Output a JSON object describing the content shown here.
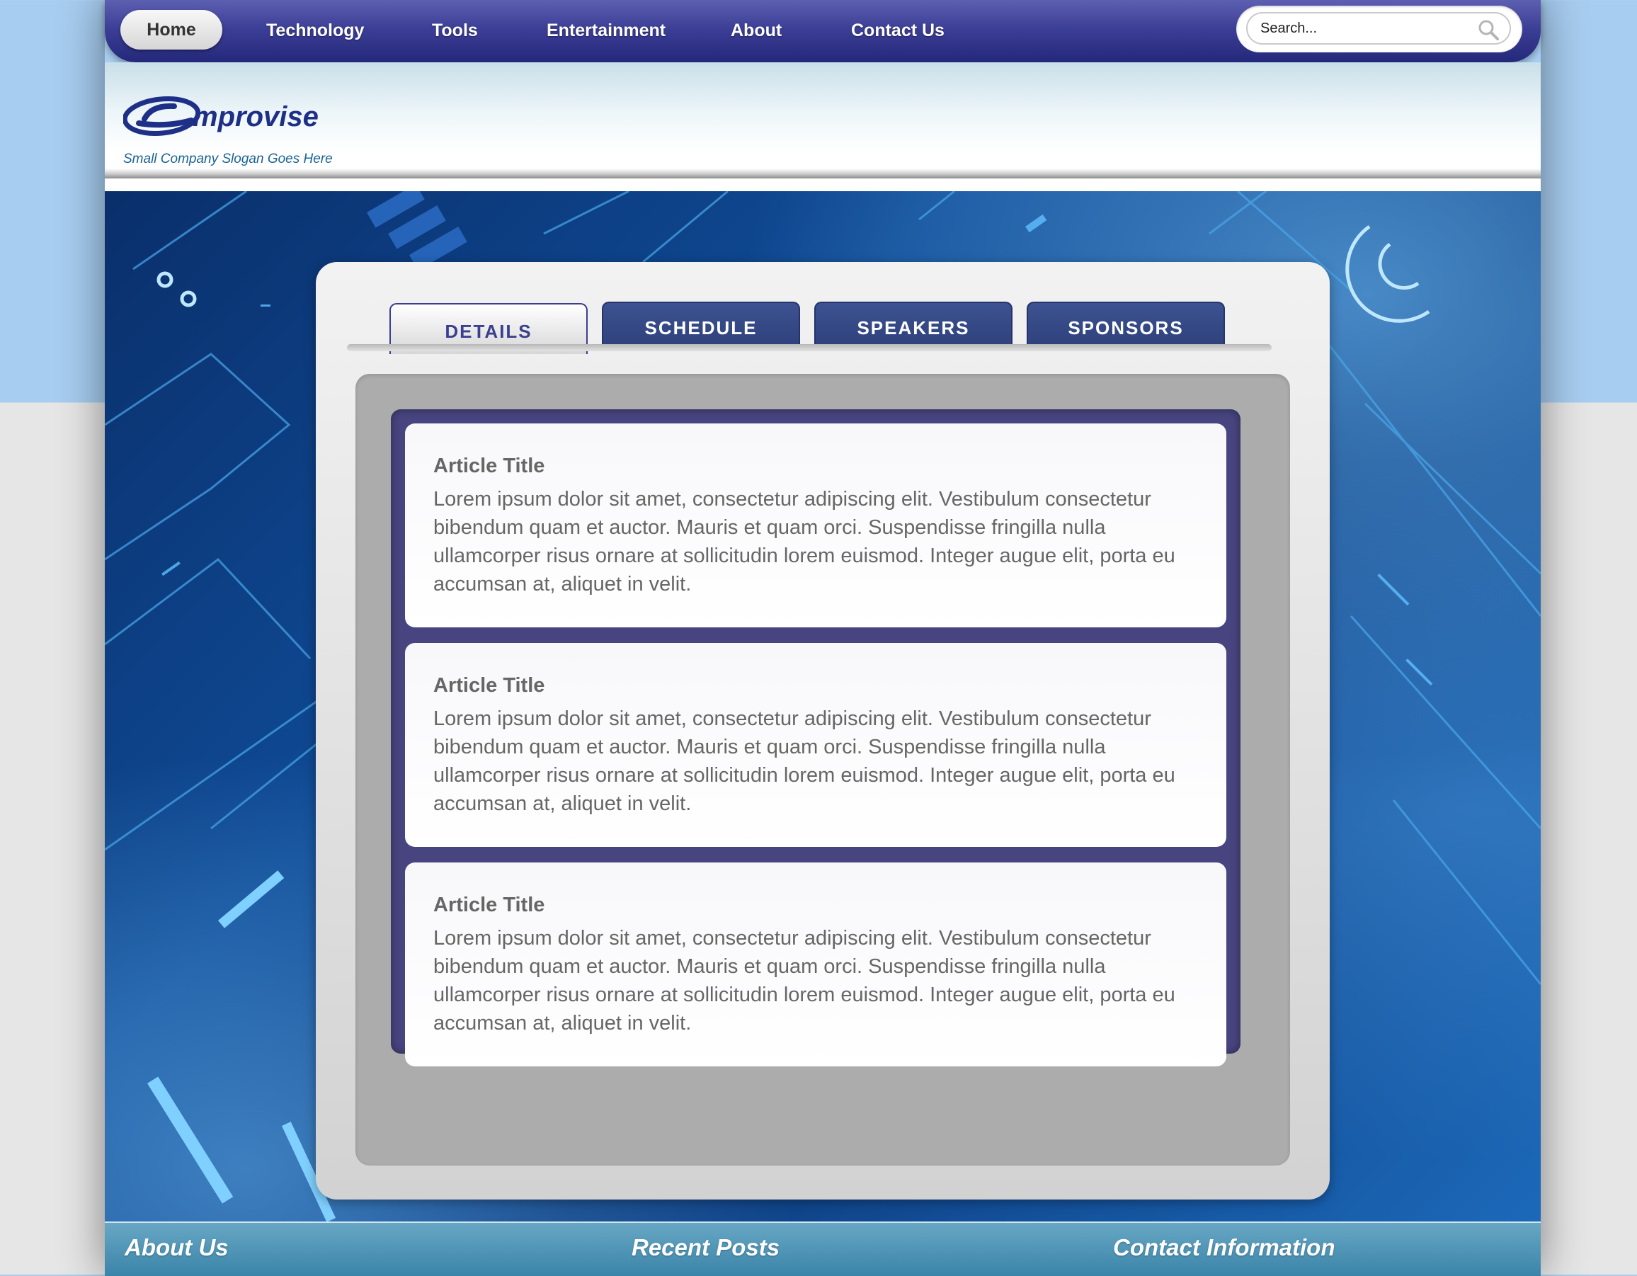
{
  "nav": {
    "items": [
      {
        "label": "Home"
      },
      {
        "label": "Technology"
      },
      {
        "label": "Tools"
      },
      {
        "label": "Entertainment"
      },
      {
        "label": "About"
      },
      {
        "label": "Contact Us"
      }
    ],
    "search": {
      "placeholder": "Search...",
      "icon": "search-icon"
    }
  },
  "header": {
    "logo_text": "Emprovise",
    "slogan": "Small Company Slogan Goes Here"
  },
  "tabs": [
    {
      "label": "DETAILS",
      "active": true
    },
    {
      "label": "SCHEDULE",
      "active": false
    },
    {
      "label": "SPEAKERS",
      "active": false
    },
    {
      "label": "SPONSORS",
      "active": false
    }
  ],
  "articles": [
    {
      "title": "Article Title",
      "body": "Lorem ipsum dolor sit amet, consectetur adipiscing elit. Vestibulum consectetur bibendum quam et auctor. Mauris et quam orci. Suspendisse fringilla nulla ullamcorper risus ornare at sollicitudin lorem euismod. Integer augue elit, porta eu accumsan at, aliquet in velit."
    },
    {
      "title": "Article Title",
      "body": "Lorem ipsum dolor sit amet, consectetur adipiscing elit. Vestibulum consectetur bibendum quam et auctor. Mauris et quam orci. Suspendisse fringilla nulla ullamcorper risus ornare at sollicitudin lorem euismod. Integer augue elit, porta eu accumsan at, aliquet in velit."
    },
    {
      "title": "Article Title",
      "body": "Lorem ipsum dolor sit amet, consectetur adipiscing elit. Vestibulum consectetur bibendum quam et auctor. Mauris et quam orci. Suspendisse fringilla nulla ullamcorper risus ornare at sollicitudin lorem euismod. Integer augue elit, porta eu accumsan at, aliquet in velit."
    }
  ],
  "footer": {
    "headings": [
      {
        "label": "About Us"
      },
      {
        "label": "Recent Posts"
      },
      {
        "label": "Contact Information"
      }
    ]
  },
  "colors": {
    "nav_blue": "#3c3f96",
    "tab_blue": "#2d3f7b",
    "article_frame": "#48447f",
    "footer_teal": "#3a84a9",
    "slogan_blue": "#1a6392"
  }
}
